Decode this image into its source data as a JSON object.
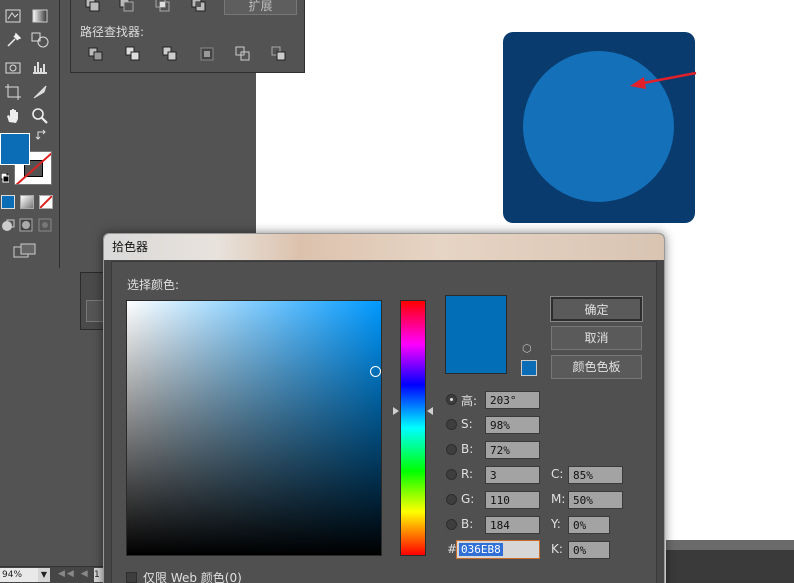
{
  "pathfinder": {
    "expand_label": "扩展",
    "finder_label": "路径查找器:"
  },
  "dialog": {
    "title": "拾色器",
    "select_color_label": "选择颜色:",
    "buttons": {
      "ok": "确定",
      "cancel": "取消",
      "swatches": "颜色色板"
    },
    "hsb": [
      {
        "label": "高:",
        "value": "203°",
        "selected": true
      },
      {
        "label": "S:",
        "value": "98%",
        "selected": false
      },
      {
        "label": "B:",
        "value": "72%",
        "selected": false
      }
    ],
    "rgb": [
      {
        "label": "R:",
        "value": "3"
      },
      {
        "label": "G:",
        "value": "110"
      },
      {
        "label": "B:",
        "value": "184"
      }
    ],
    "cmyk": [
      {
        "label": "C:",
        "value": "85%"
      },
      {
        "label": "M:",
        "value": "50%"
      },
      {
        "label": "Y:",
        "value": "0%"
      },
      {
        "label": "K:",
        "value": "0%"
      }
    ],
    "hex_label": "#",
    "hex_value": "036EB8",
    "web_only_label": "仅限 Web 颜色(0)"
  },
  "status": {
    "zoom": "94%",
    "page": "1"
  },
  "colors": {
    "selected": "#036EB8",
    "art_square": "#0a3b6e",
    "art_circle": "#1470b8",
    "arrow": "#e0202a",
    "fill_swatch": "#0a6db5"
  },
  "icons": {
    "toolbox": [
      "symbol-sprayer-icon",
      "gradient-icon",
      "eyedropper-icon",
      "blend-icon",
      "camera-icon",
      "graph-icon",
      "artboard-icon",
      "slice-icon",
      "hand-icon",
      "zoom-icon",
      "swap-icon",
      "default-colors-icon",
      "color-mode-icon",
      "gradient-mode-icon",
      "none-icon",
      "draw-normal-icon",
      "draw-behind-icon",
      "draw-inside-icon",
      "screen-mode-icon"
    ],
    "pathfinder": [
      "unite-icon",
      "minus-front-icon",
      "intersect-icon",
      "exclude-icon",
      "divide-icon",
      "trim-icon",
      "merge-icon",
      "crop-icon",
      "outline-icon",
      "minus-back-icon"
    ]
  }
}
